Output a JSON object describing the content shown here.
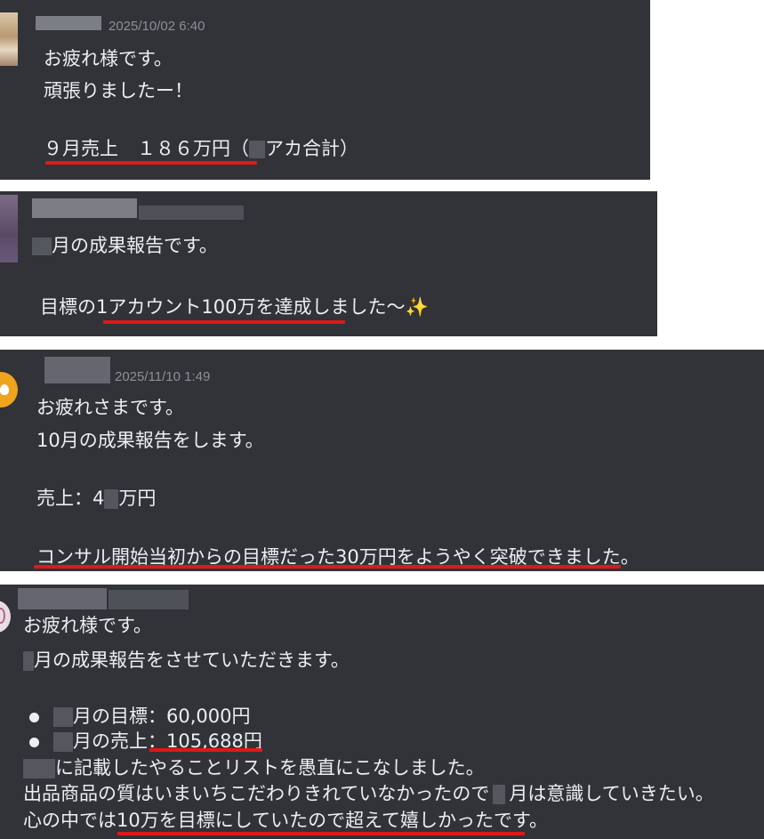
{
  "colors": {
    "card_bg": "#313338",
    "text": "#eceef2",
    "timestamp": "#8d8f96",
    "underline": "#e01818",
    "sparkle": "#f6c443"
  },
  "messages": [
    {
      "timestamp": "2025/10/02 6:40",
      "lines": [
        "お疲れ様です。",
        "頑張りましたー！"
      ],
      "highlight_a": "９月売上　１８６万円（",
      "highlight_b": "アカ合計）"
    },
    {
      "line1_suffix": "月の成果報告です。",
      "line2": "目標の1アカウント100万を達成しました〜",
      "sparkle_icon": "sparkles-icon"
    },
    {
      "timestamp": "2025/11/10 1:49",
      "lines": [
        "お疲れさまです。",
        "10月の成果報告をします。"
      ],
      "sales_a": "売上：4",
      "sales_b": "万円",
      "goal_line": "コンサル開始当初からの目標だった30万円をようやく突破できました。"
    },
    {
      "greeting": "お疲れ様です。",
      "report_line": "月の成果報告をさせていただきます。",
      "bullets": [
        {
          "label": "月の目標：60,000円"
        },
        {
          "label": "月の売上：105,688円"
        }
      ],
      "line_list": "に記載したやることリストを愚直にこなしました。",
      "line_quality_a": "出品商品の質はいまいちこだわりきれていなかったので",
      "line_quality_b": "月は意識していきたい。",
      "line_heart": "心の中では10万を目標にしていたので超えて嬉しかったです。"
    }
  ]
}
